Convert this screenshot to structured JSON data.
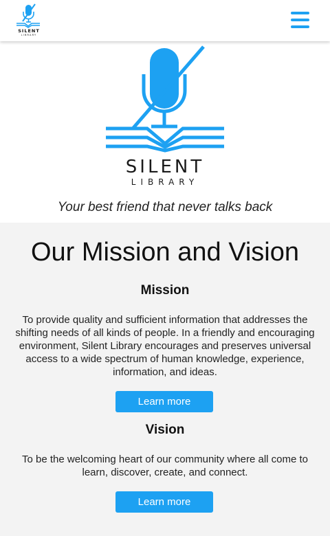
{
  "header": {
    "logo_wordmark": "SILENT",
    "logo_sub": "LIBRARY",
    "menu_icon": "hamburger-menu-icon",
    "accent_color": "#1da1f2"
  },
  "hero": {
    "brand_name": "SILENT",
    "brand_sub": "LIBRARY",
    "logo_icon": "crossed-microphone-book-icon",
    "tagline": "Your best friend that never talks back"
  },
  "mission_vision": {
    "title": "Our Mission and Vision",
    "mission": {
      "heading": "Mission",
      "text": "To provide quality and sufficient information that addresses the shifting needs of all kinds of people. In a friendly and encouraging environment, Silent Library encourages and preserves universal access to a wide spectrum of human knowledge, experience, information, and ideas.",
      "button_label": "Learn more"
    },
    "vision": {
      "heading": "Vision",
      "text": "To be the welcoming heart of our community where all come to learn, discover, create, and connect.",
      "button_label": "Learn more"
    }
  }
}
